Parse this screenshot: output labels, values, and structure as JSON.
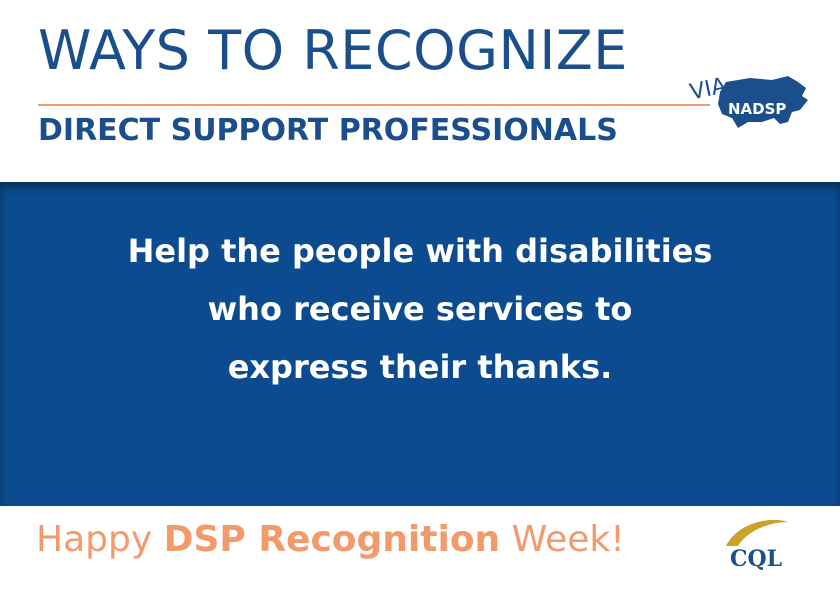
{
  "header": {
    "title": "WAYS TO RECOGNIZE",
    "subtitle": "DIRECT SUPPORT PROFESSIONALS",
    "badge_via": "VIA",
    "badge_org": "NADSP"
  },
  "main": {
    "lines": [
      "Help the people with disabilities",
      "who receive services to",
      "express their thanks."
    ]
  },
  "footer": {
    "greeting_pre": "Happy ",
    "greeting_strong": "DSP Recognition",
    "greeting_post": " Week!",
    "logo_text": "CQL"
  },
  "colors": {
    "navy": "#1b4f8c",
    "band_blue": "#0c4b8f",
    "accent_orange": "#f39a6b",
    "cql_gold": "#c9a227"
  }
}
